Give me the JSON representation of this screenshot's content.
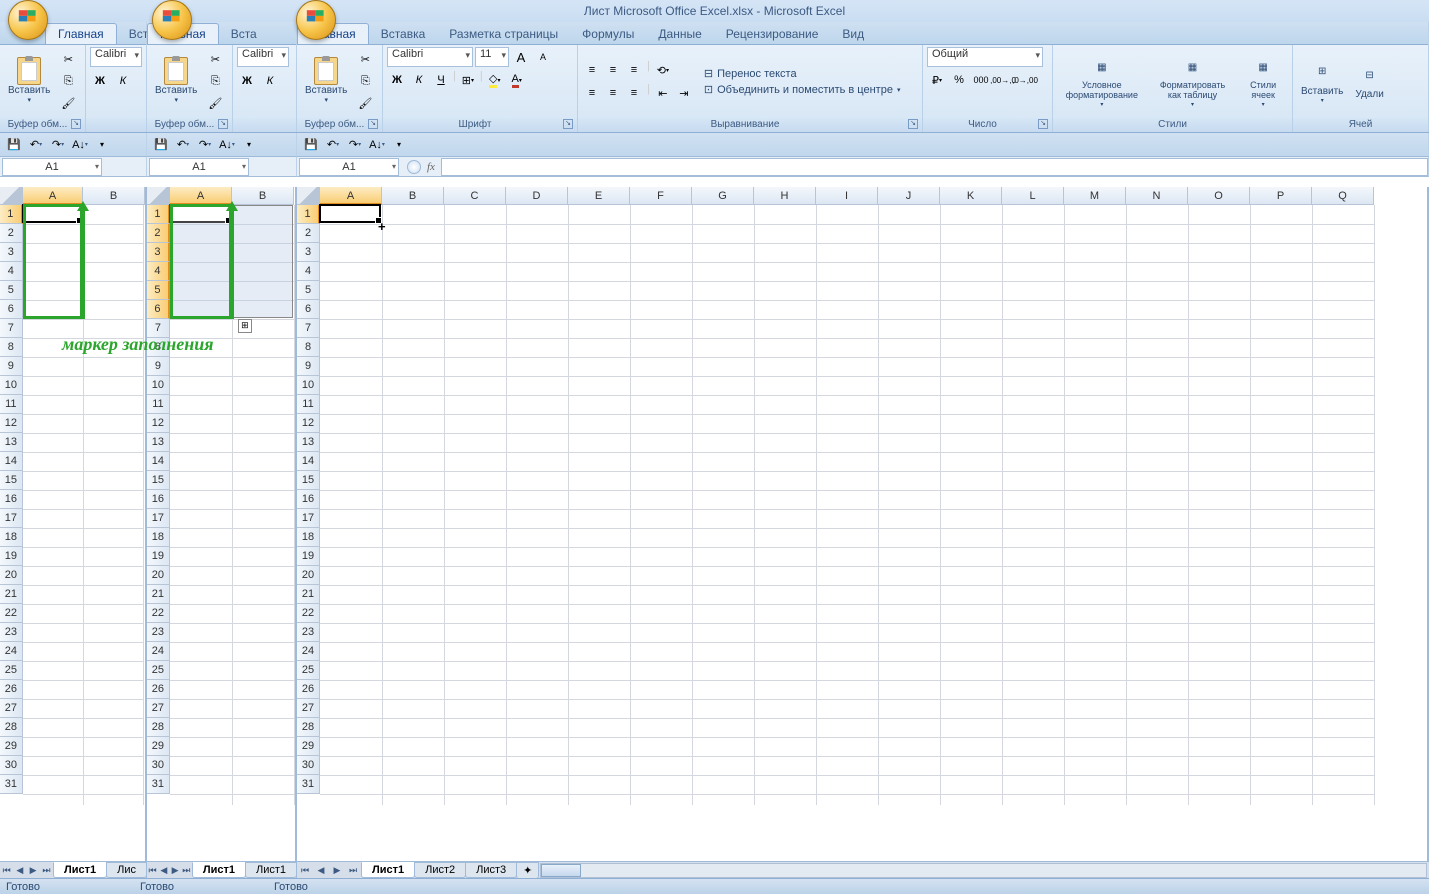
{
  "title": "Лист Microsoft Office Excel.xlsx - Microsoft Excel",
  "tabs": {
    "home": "Главная",
    "insert": "Вставка",
    "insert_short": "Вста",
    "layout": "Разметка страницы",
    "formulas": "Формулы",
    "data": "Данные",
    "review": "Рецензирование",
    "view": "Вид"
  },
  "ribbon": {
    "clipboard": {
      "paste": "Вставить",
      "label": "Буфер обм..."
    },
    "font": {
      "family": "Calibri",
      "size": "11",
      "label": "Шрифт",
      "bold": "Ж",
      "italic": "К",
      "underline": "Ч"
    },
    "alignment": {
      "wrap": "Перенос текста",
      "merge": "Объединить и поместить в центре",
      "label": "Выравнивание"
    },
    "number": {
      "format": "Общий",
      "label": "Число"
    },
    "styles": {
      "cond": "Условное форматирование",
      "table": "Форматировать как таблицу",
      "cell": "Стили ячеек",
      "label": "Стили"
    },
    "cells": {
      "insert": "Вставить",
      "delete": "Удали",
      "label": "Ячей"
    }
  },
  "name_box": "A1",
  "columns": [
    "A",
    "B",
    "C",
    "D",
    "E",
    "F",
    "G",
    "H",
    "I",
    "J",
    "K",
    "L",
    "M",
    "N",
    "O",
    "P",
    "Q"
  ],
  "rows31": 31,
  "annotation_text": "маркер заполнения",
  "sheets": {
    "s1": "Лист1",
    "s2": "Лист2",
    "s3": "Лист3",
    "s1_short": "Лис",
    "s1_cut": "Лист1"
  },
  "status": "Готово"
}
